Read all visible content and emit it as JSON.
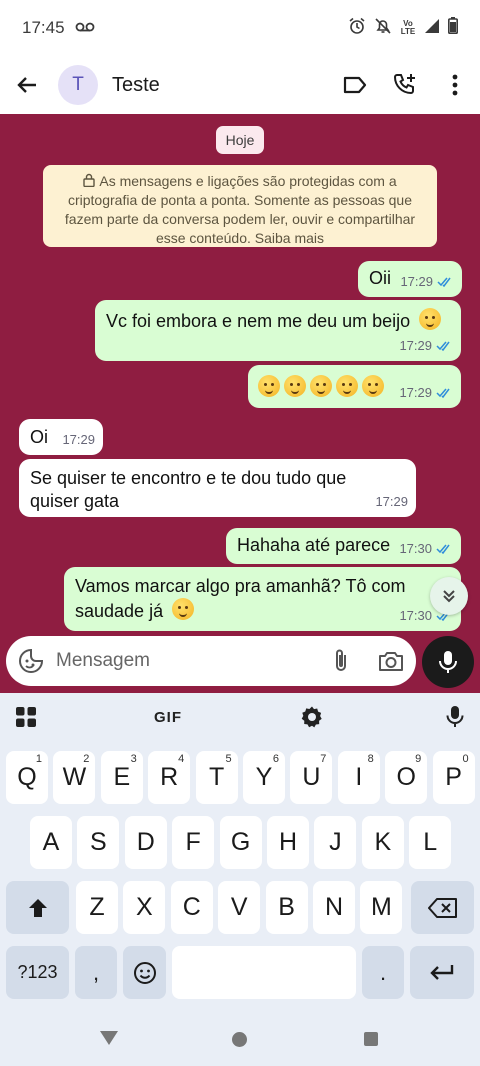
{
  "status_bar": {
    "time": "17:45",
    "network": "Vo LTE"
  },
  "header": {
    "avatar_letter": "T",
    "contact_name": "Teste"
  },
  "chat": {
    "date_chip": "Hoje",
    "encryption_notice": "As mensagens e ligações são protegidas com a criptografia de ponta a ponta. Somente as pessoas que fazem parte da conversa podem ler, ouvir e compartilhar esse conteúdo. Saiba mais",
    "messages": [
      {
        "dir": "out",
        "text": "Oii",
        "time": "17:29"
      },
      {
        "dir": "out",
        "text": "Vc foi embora e nem me deu um beijo",
        "time": "17:29"
      },
      {
        "dir": "out",
        "text": "",
        "time": "17:29"
      },
      {
        "dir": "in",
        "text": "Oi",
        "time": "17:29"
      },
      {
        "dir": "in",
        "text": "Se quiser te encontro e te dou tudo que quiser gata",
        "time": "17:29"
      },
      {
        "dir": "out",
        "text": "Hahaha até parece",
        "time": "17:30"
      },
      {
        "dir": "out",
        "text": "Vamos marcar algo pra amanhã? Tô com saudade já",
        "time": "17:30"
      }
    ]
  },
  "composer": {
    "placeholder": "Mensagem"
  },
  "keyboard": {
    "toolbar": {
      "gif": "GIF"
    },
    "row1": [
      {
        "k": "Q",
        "n": "1"
      },
      {
        "k": "W",
        "n": "2"
      },
      {
        "k": "E",
        "n": "3"
      },
      {
        "k": "R",
        "n": "4"
      },
      {
        "k": "T",
        "n": "5"
      },
      {
        "k": "Y",
        "n": "6"
      },
      {
        "k": "U",
        "n": "7"
      },
      {
        "k": "I",
        "n": "8"
      },
      {
        "k": "O",
        "n": "9"
      },
      {
        "k": "P",
        "n": "0"
      }
    ],
    "row2": [
      "A",
      "S",
      "D",
      "F",
      "G",
      "H",
      "J",
      "K",
      "L"
    ],
    "row3": [
      "Z",
      "X",
      "C",
      "V",
      "B",
      "N",
      "M"
    ],
    "symbols": "?123",
    "comma": ",",
    "period": "."
  }
}
